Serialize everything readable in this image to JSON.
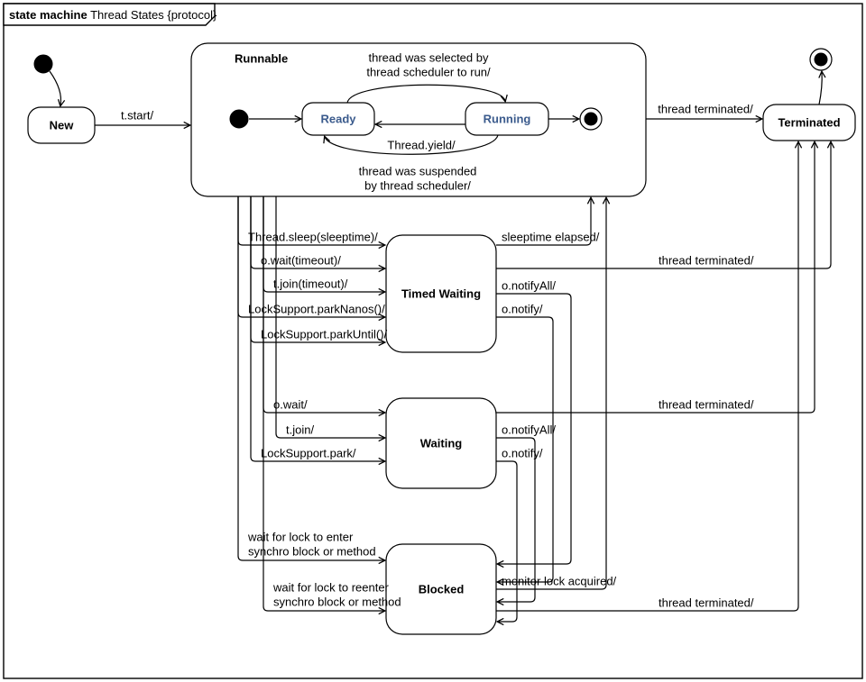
{
  "diagram": {
    "type": "uml_state_machine",
    "title_prefix": "state machine",
    "title_name": "Thread States {protocol}",
    "states": {
      "new": "New",
      "runnable": "Runnable",
      "ready": "Ready",
      "running": "Running",
      "timed_waiting": "Timed Waiting",
      "waiting": "Waiting",
      "blocked": "Blocked",
      "terminated": "Terminated"
    },
    "runnable_internal_transitions": {
      "selected_l1": "thread was selected by",
      "selected_l2": "thread scheduler to run/",
      "yield": "Thread.yield/",
      "suspend_l1": "thread was suspended",
      "suspend_l2": "by thread scheduler/"
    },
    "transitions": {
      "new_to_runnable": "t.start/",
      "runnable_to_terminated": "thread terminated/",
      "to_timed_waiting": [
        "Thread.sleep(sleeptime)/",
        "o.wait(timeout)/",
        "t.join(timeout)/",
        "LockSupport.parkNanos()/",
        "LockSupport.parkUntil()/"
      ],
      "tw_sleeptime": "sleeptime elapsed/",
      "tw_terminated": "thread terminated/",
      "tw_notifyall": "o.notifyAll/",
      "tw_notify": "o.notify/",
      "to_waiting": [
        "o.wait/",
        "t.join/",
        "LockSupport.park/"
      ],
      "w_terminated": "thread terminated/",
      "w_notifyall": "o.notifyAll/",
      "w_notify": "o.notify/",
      "to_blocked_enter_l1": "wait for lock to enter",
      "to_blocked_enter_l2": "synchro block or method",
      "to_blocked_reenter_l1": "wait for lock to reenter",
      "to_blocked_reenter_l2": "synchro block or method",
      "blk_lock": "monitor lock acquired/",
      "blk_terminated": "thread terminated/"
    }
  }
}
